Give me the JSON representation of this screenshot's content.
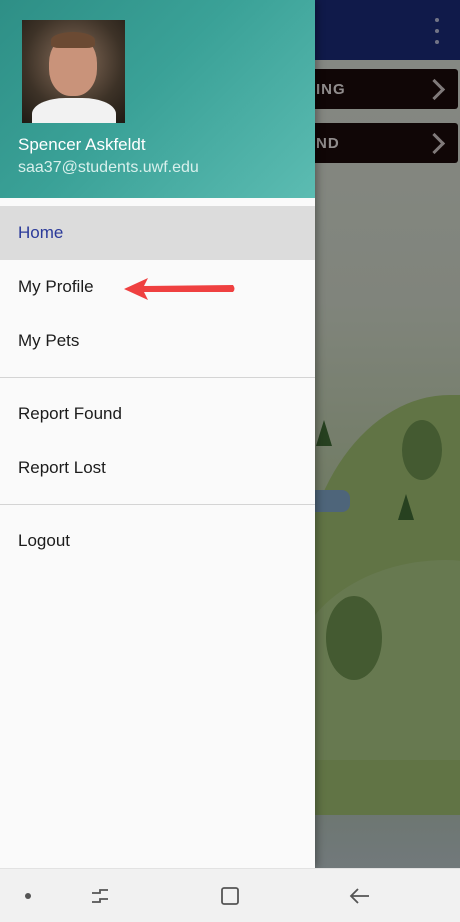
{
  "background": {
    "toolbar_color": "#1b2a78",
    "cards": [
      {
        "label": "ING"
      },
      {
        "label": "ND"
      }
    ]
  },
  "drawer": {
    "header": {
      "user_name": "Spencer Askfeldt",
      "user_email": "saa37@students.uwf.edu",
      "gradient_color": "#3aa197"
    },
    "menu_groups": [
      [
        {
          "label": "Home",
          "active": true
        },
        {
          "label": "My Profile"
        },
        {
          "label": "My Pets"
        }
      ],
      [
        {
          "label": "Report Found"
        },
        {
          "label": "Report Lost"
        }
      ],
      [
        {
          "label": "Logout"
        }
      ]
    ],
    "active_color": "#2b3a9a"
  },
  "annotation": {
    "arrow_color": "#ef4040",
    "points_to": "My Profile"
  },
  "navbar": {
    "icons": [
      "dot-icon",
      "recent-apps-icon",
      "home-icon",
      "back-icon"
    ]
  }
}
